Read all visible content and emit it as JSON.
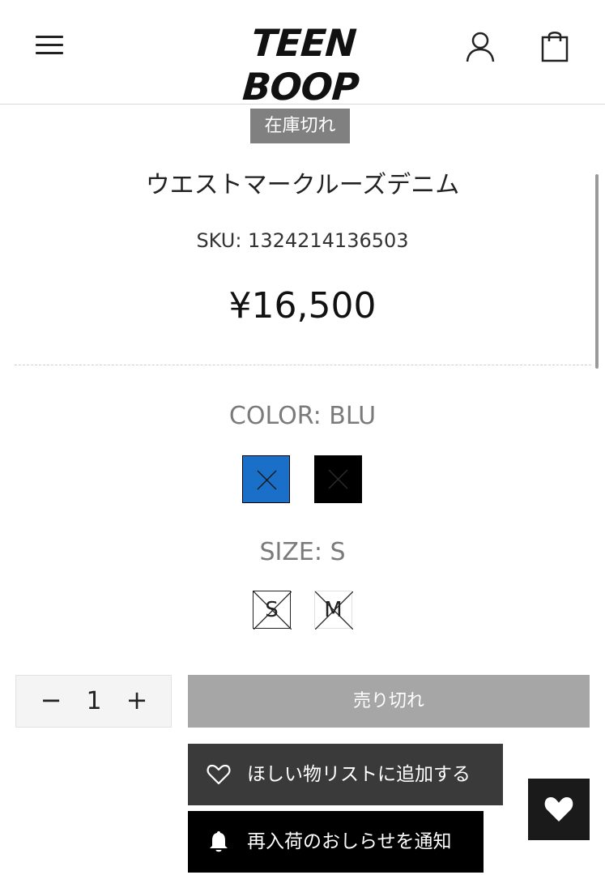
{
  "header": {
    "menu_icon": "hamburger-menu-icon",
    "logo_text": "TEEN BOOP",
    "account_icon": "user-icon",
    "cart_icon": "shopping-bag-icon"
  },
  "product": {
    "badge": "在庫切れ",
    "title": "ウエストマークルーズデニム",
    "sku": "SKU: 1324214136503",
    "price": "¥16,500"
  },
  "options": {
    "color_label": "COLOR: BLU",
    "colors": [
      {
        "name": "BLU",
        "hex": "#1a6fc9",
        "selected": true,
        "sold_out": true
      },
      {
        "name": "BLK",
        "hex": "#000000",
        "selected": false,
        "sold_out": true
      }
    ],
    "size_label": "SIZE: S",
    "sizes": [
      {
        "label": "S",
        "selected": true,
        "sold_out": true
      },
      {
        "label": "M",
        "selected": false,
        "sold_out": true
      }
    ]
  },
  "purchase": {
    "qty_minus": "−",
    "qty_value": "1",
    "qty_plus": "+",
    "soldout_label": "売り切れ",
    "wishlist_label": "ほしい物リストに追加する",
    "wishlist_icon": "heart-outline-icon",
    "notify_label": "再入荷のおしらせを通知",
    "notify_icon": "bell-icon"
  },
  "floating": {
    "wishlist_icon": "heart-filled-icon"
  },
  "colors": {
    "badge_bg": "#808080",
    "soldout_bg": "#a6a6a6",
    "wishlist_bg": "#3a3a3a",
    "notify_bg": "#000000"
  }
}
